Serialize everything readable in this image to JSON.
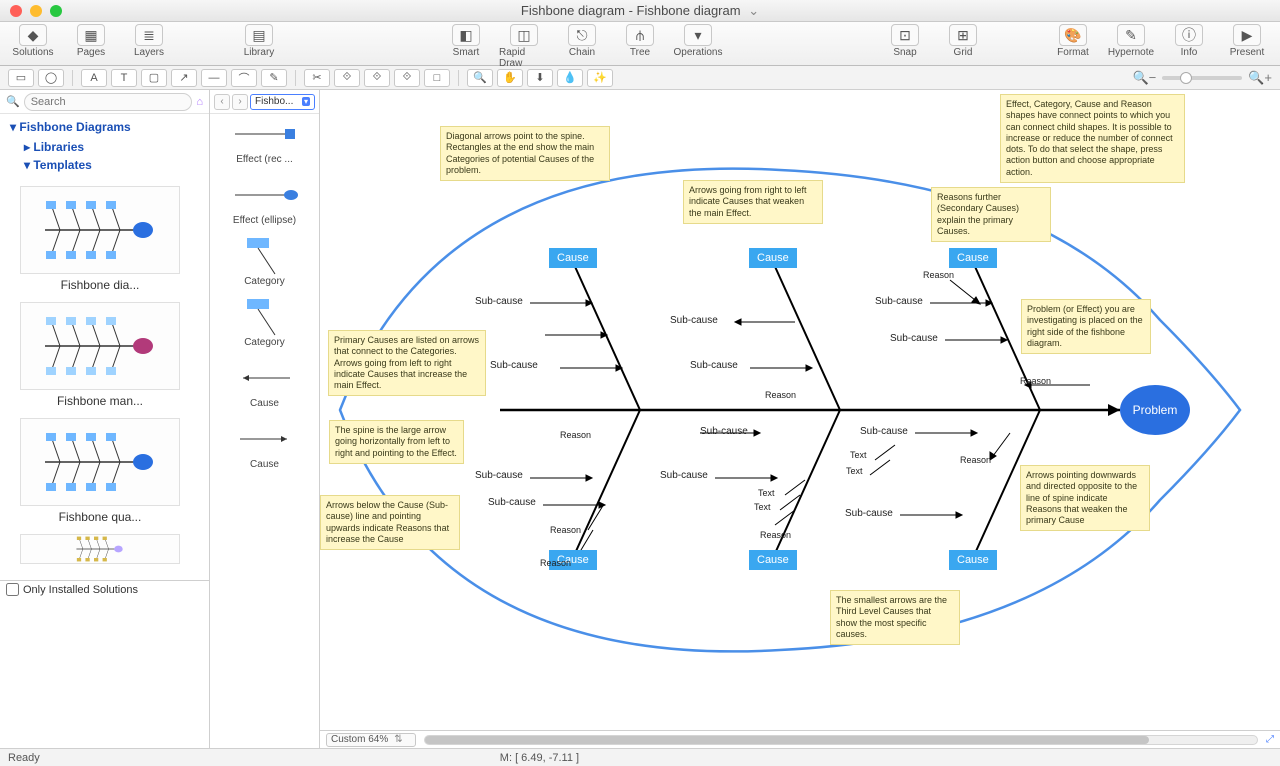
{
  "window": {
    "title": "Fishbone diagram - Fishbone diagram"
  },
  "toolbar": {
    "left": [
      {
        "label": "Solutions",
        "icon": "◆"
      },
      {
        "label": "Pages",
        "icon": "▦"
      },
      {
        "label": "Layers",
        "icon": "≣"
      }
    ],
    "library": {
      "label": "Library",
      "icon": "▤"
    },
    "mid": [
      {
        "label": "Smart",
        "icon": "◧"
      },
      {
        "label": "Rapid Draw",
        "icon": "◫"
      },
      {
        "label": "Chain",
        "icon": "⎋"
      },
      {
        "label": "Tree",
        "icon": "⫛"
      },
      {
        "label": "Operations",
        "icon": "▾"
      }
    ],
    "snapgrid": [
      {
        "label": "Snap",
        "icon": "⊡"
      },
      {
        "label": "Grid",
        "icon": "⊞"
      }
    ],
    "right": [
      {
        "label": "Format",
        "icon": "🎨"
      },
      {
        "label": "Hypernote",
        "icon": "✎"
      },
      {
        "label": "Info",
        "icon": "ⓘ"
      },
      {
        "label": "Present",
        "icon": "▶"
      }
    ]
  },
  "tools2": [
    "▭",
    "◯",
    "A",
    "T",
    "▢",
    "↗",
    "—",
    "⌒",
    "✎",
    "✂",
    "⟐",
    "⟐",
    "⟐",
    "□",
    "🔍",
    "✋",
    "⬇",
    "💧",
    "✨"
  ],
  "search": {
    "placeholder": "Search"
  },
  "tree": {
    "header": "Fishbone Diagrams",
    "items": [
      "Libraries",
      "Templates"
    ]
  },
  "thumbs": [
    {
      "cap": "Fishbone dia...",
      "head": "#2a6fe0",
      "box": "#6fb7ff"
    },
    {
      "cap": "Fishbone man...",
      "head": "#b23a7a",
      "box": "#9fd3ff"
    },
    {
      "cap": "Fishbone qua...",
      "head": "#2a6fe0",
      "box": "#6fb7ff"
    }
  ],
  "ois": {
    "label": "Only Installed Solutions"
  },
  "palette": {
    "selector": "Fishbo...",
    "items": [
      {
        "label": "",
        "kind": "effect-rect"
      },
      {
        "label": "Effect (rec ...",
        "kind": "label"
      },
      {
        "label": "",
        "kind": "effect-ellipse"
      },
      {
        "label": "Effect (ellipse)",
        "kind": "label"
      },
      {
        "label": "",
        "kind": "category1"
      },
      {
        "label": "Category",
        "kind": "label"
      },
      {
        "label": "",
        "kind": "category2"
      },
      {
        "label": "Category",
        "kind": "label"
      },
      {
        "label": "",
        "kind": "arrow-l"
      },
      {
        "label": "Cause",
        "kind": "label"
      },
      {
        "label": "",
        "kind": "arrow-r"
      },
      {
        "label": "Cause",
        "kind": "label"
      }
    ]
  },
  "canvas": {
    "problem": "Problem",
    "causes": [
      "Cause",
      "Cause",
      "Cause",
      "Cause",
      "Cause",
      "Cause"
    ],
    "labels": {
      "subcause": "Sub-cause",
      "reason": "Reason",
      "text": "Text"
    },
    "notes": {
      "diagonal": "Diagonal arrows point to the spine. Rectangles at the end show the main Categories of potential Causes of the problem.",
      "rtl": "Arrows going from right to left indicate Causes that weaken the main Effect.",
      "reasons": "Reasons further (Secondary Causes) explain the primary Causes.",
      "connect": "Effect, Category, Cause and Reason shapes have connect points to which you can connect child shapes. It is possible to increase or reduce the number of connect dots. To do that select the shape, press action button and choose appropriate action.",
      "primary": "Primary Causes are listed on arrows that connect to the Categories. Arrows going from left to right indicate Causes that increase the main Effect.",
      "spine": "The spine is the large arrow going horizontally from left to right and pointing to the Effect.",
      "below": "Arrows below the Cause (Sub-cause) line and pointing upwards indicate Reasons that increase the Cause",
      "probnote": "Problem (or Effect) you are investigating is placed on the right side of the fishbone diagram.",
      "down": "Arrows pointing downwards and directed opposite to the line of spine indicate Reasons that weaken the primary Cause",
      "smallest": "The smallest arrows are the Third Level Causes that show the most specific causes."
    }
  },
  "canvasbar": {
    "zoom": "Custom 64%"
  },
  "status": {
    "ready": "Ready",
    "coord": "M: [ 6.49, -7.11 ]"
  }
}
